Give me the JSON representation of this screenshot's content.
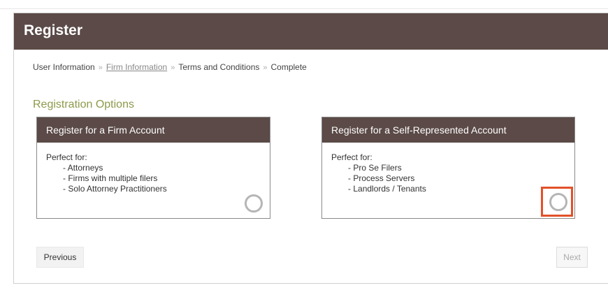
{
  "header": {
    "title": "Register"
  },
  "breadcrumb": {
    "steps": [
      {
        "label": "User Information"
      },
      {
        "label": "Firm Information"
      },
      {
        "label": "Terms and Conditions"
      },
      {
        "label": "Complete"
      }
    ],
    "separator": "»",
    "active_step": "Firm Information"
  },
  "options": {
    "title": "Registration Options",
    "firm": {
      "heading": "Register for a Firm Account",
      "intro": "Perfect for:",
      "items": [
        "Attorneys",
        "Firms with multiple filers",
        "Solo Attorney Practitioners"
      ],
      "selected": false
    },
    "self": {
      "heading": "Register for a Self-Represented Account",
      "intro": "Perfect for:",
      "items": [
        "Pro Se Filers",
        "Process Servers",
        "Landlords / Tenants"
      ],
      "selected": false,
      "highlighted": true
    }
  },
  "buttons": {
    "previous": "Previous",
    "next": "Next"
  },
  "colors": {
    "header_bg": "#5b4a47",
    "section_title": "#8c9a4a",
    "highlight": "#e2512a"
  }
}
